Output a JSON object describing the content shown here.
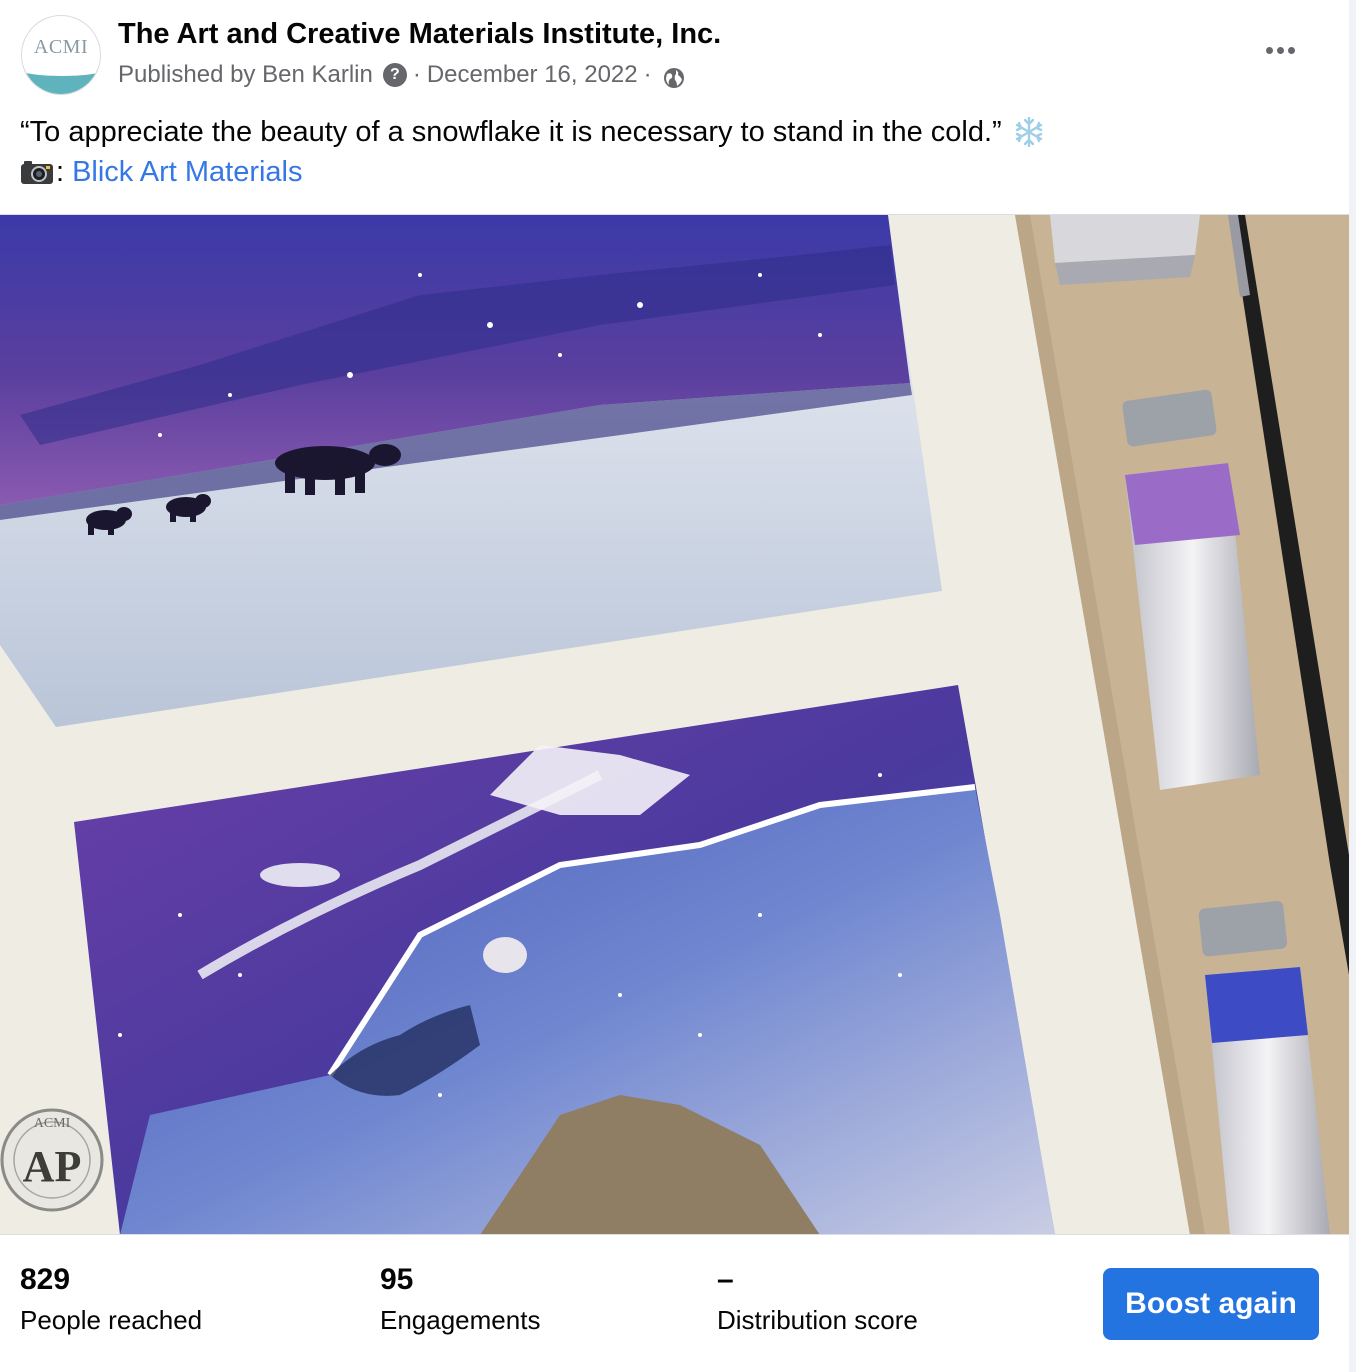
{
  "post": {
    "page_name": "The Art and Creative Materials Institute, Inc.",
    "avatar_label": "ACMI",
    "published_by": "Published by Ben Karlin",
    "help_glyph": "?",
    "separator": "·",
    "date": "December 16, 2022",
    "caption_text": "“To appreciate the beauty of a snowflake it is necessary to stand in the cold.”",
    "credit_prefix": ":",
    "credit_link": "Blick Art Materials",
    "image_seal": {
      "top": "ACMI",
      "main": "AP"
    },
    "icons": {
      "options": "more-dots-icon",
      "help": "question-circle-icon",
      "audience": "globe-icon",
      "snowflake": "snowflake-icon",
      "camera": "camera-icon"
    }
  },
  "stats": [
    {
      "value": "829",
      "label": "People reached"
    },
    {
      "value": "95",
      "label": "Engagements"
    },
    {
      "value": "–",
      "label": "Distribution score"
    }
  ],
  "actions": {
    "boost_label": "Boost again"
  },
  "colors": {
    "link": "#3578e5",
    "button": "#2374e1",
    "secondary_text": "#65676b"
  }
}
